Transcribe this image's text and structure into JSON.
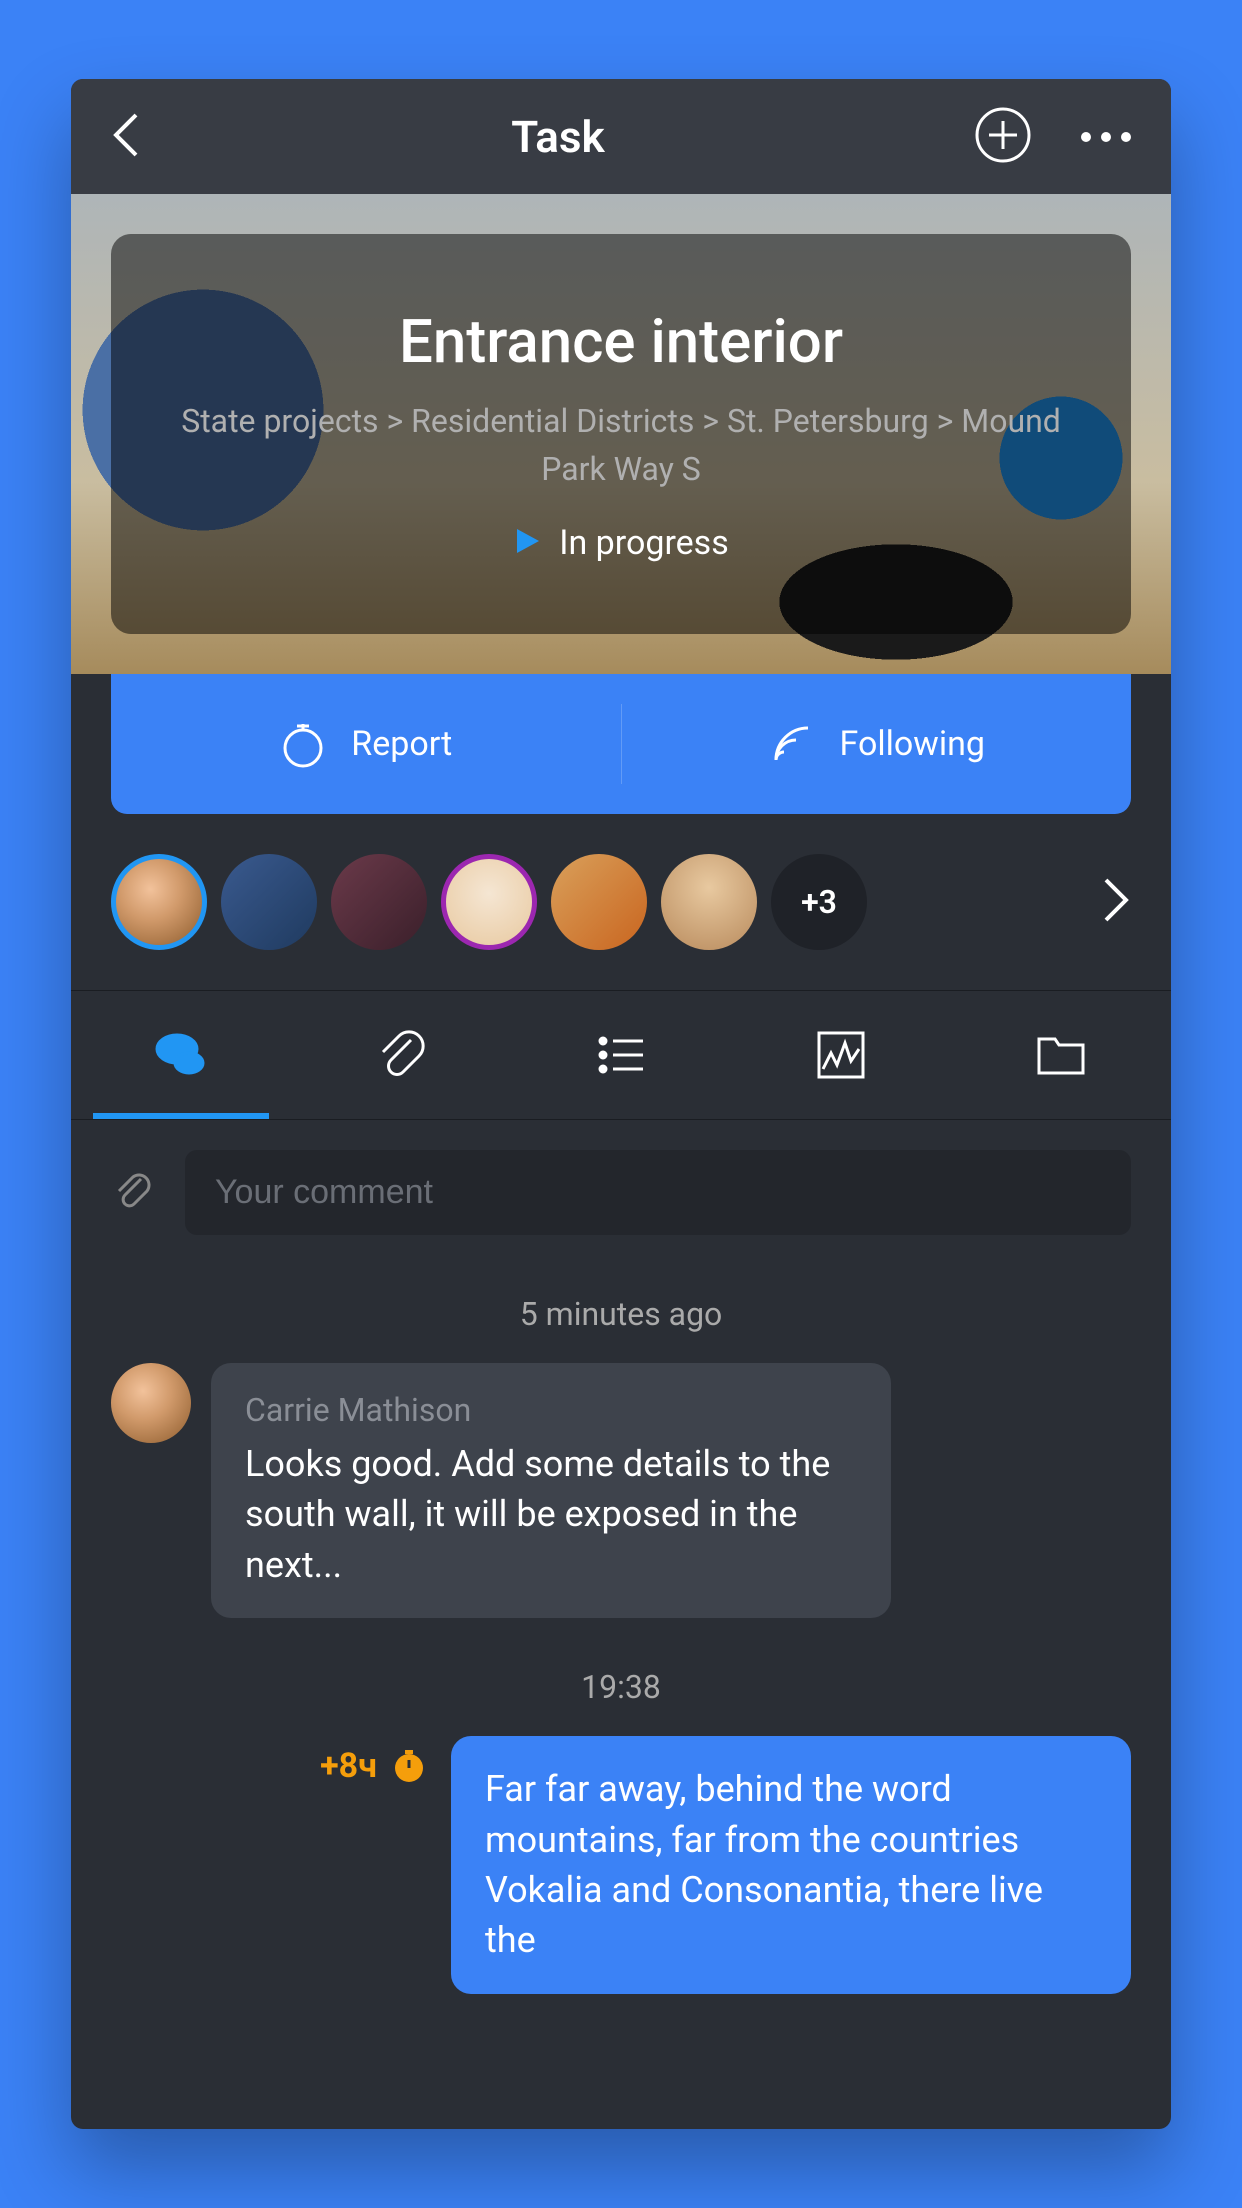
{
  "header": {
    "title": "Task"
  },
  "hero": {
    "title": "Entrance interior",
    "breadcrumb": "State projects > Residential Districts > St. Petersburg > Mound Park Way S",
    "status": "In progress"
  },
  "actions": {
    "report": "Report",
    "following": "Following"
  },
  "avatars": {
    "more": "+3"
  },
  "comment": {
    "placeholder": "Your comment"
  },
  "feed": {
    "time1": "5 minutes ago",
    "msg1": {
      "sender": "Carrie Mathison",
      "text": "Looks good. Add some details to the south wall, it will be exposed in the next..."
    },
    "time2": "19:38",
    "msg2": {
      "badge": "+8ч",
      "text": "Far far away, behind the word mountains, far from the countries Vokalia and Consonantia, there live the"
    }
  }
}
